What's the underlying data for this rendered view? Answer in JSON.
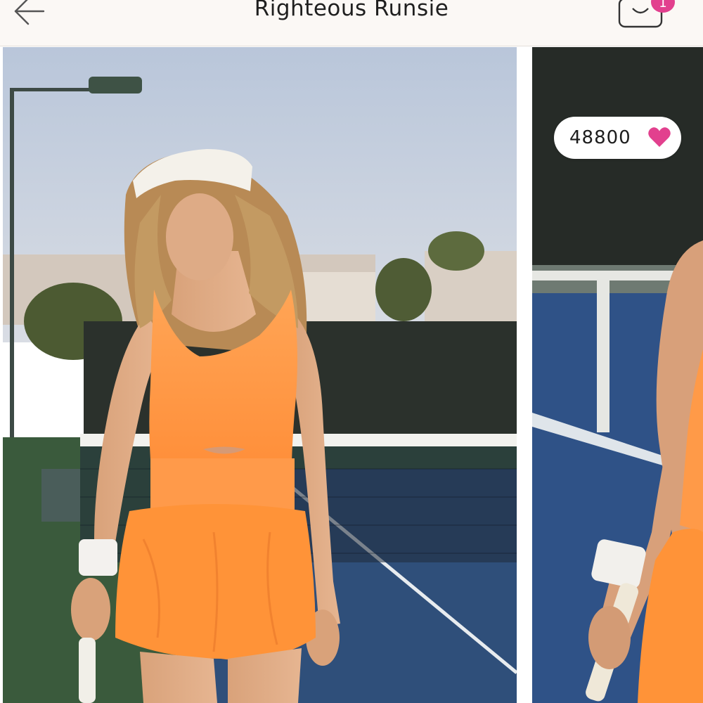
{
  "header": {
    "title": "Righteous Runsie",
    "back_icon": "arrow-left-icon",
    "cart_icon": "shopping-bag-icon",
    "cart_count": "1"
  },
  "listing": {
    "likes_count": "48800",
    "like_icon": "heart-icon"
  },
  "photos": [
    {
      "alt": "Model in orange romper on tennis court"
    },
    {
      "alt": "Model in orange romper holding tennis racket"
    }
  ],
  "colors": {
    "accent": "#e2408e",
    "header_bg": "#fbf8f5",
    "romper": "#ff9a45"
  }
}
